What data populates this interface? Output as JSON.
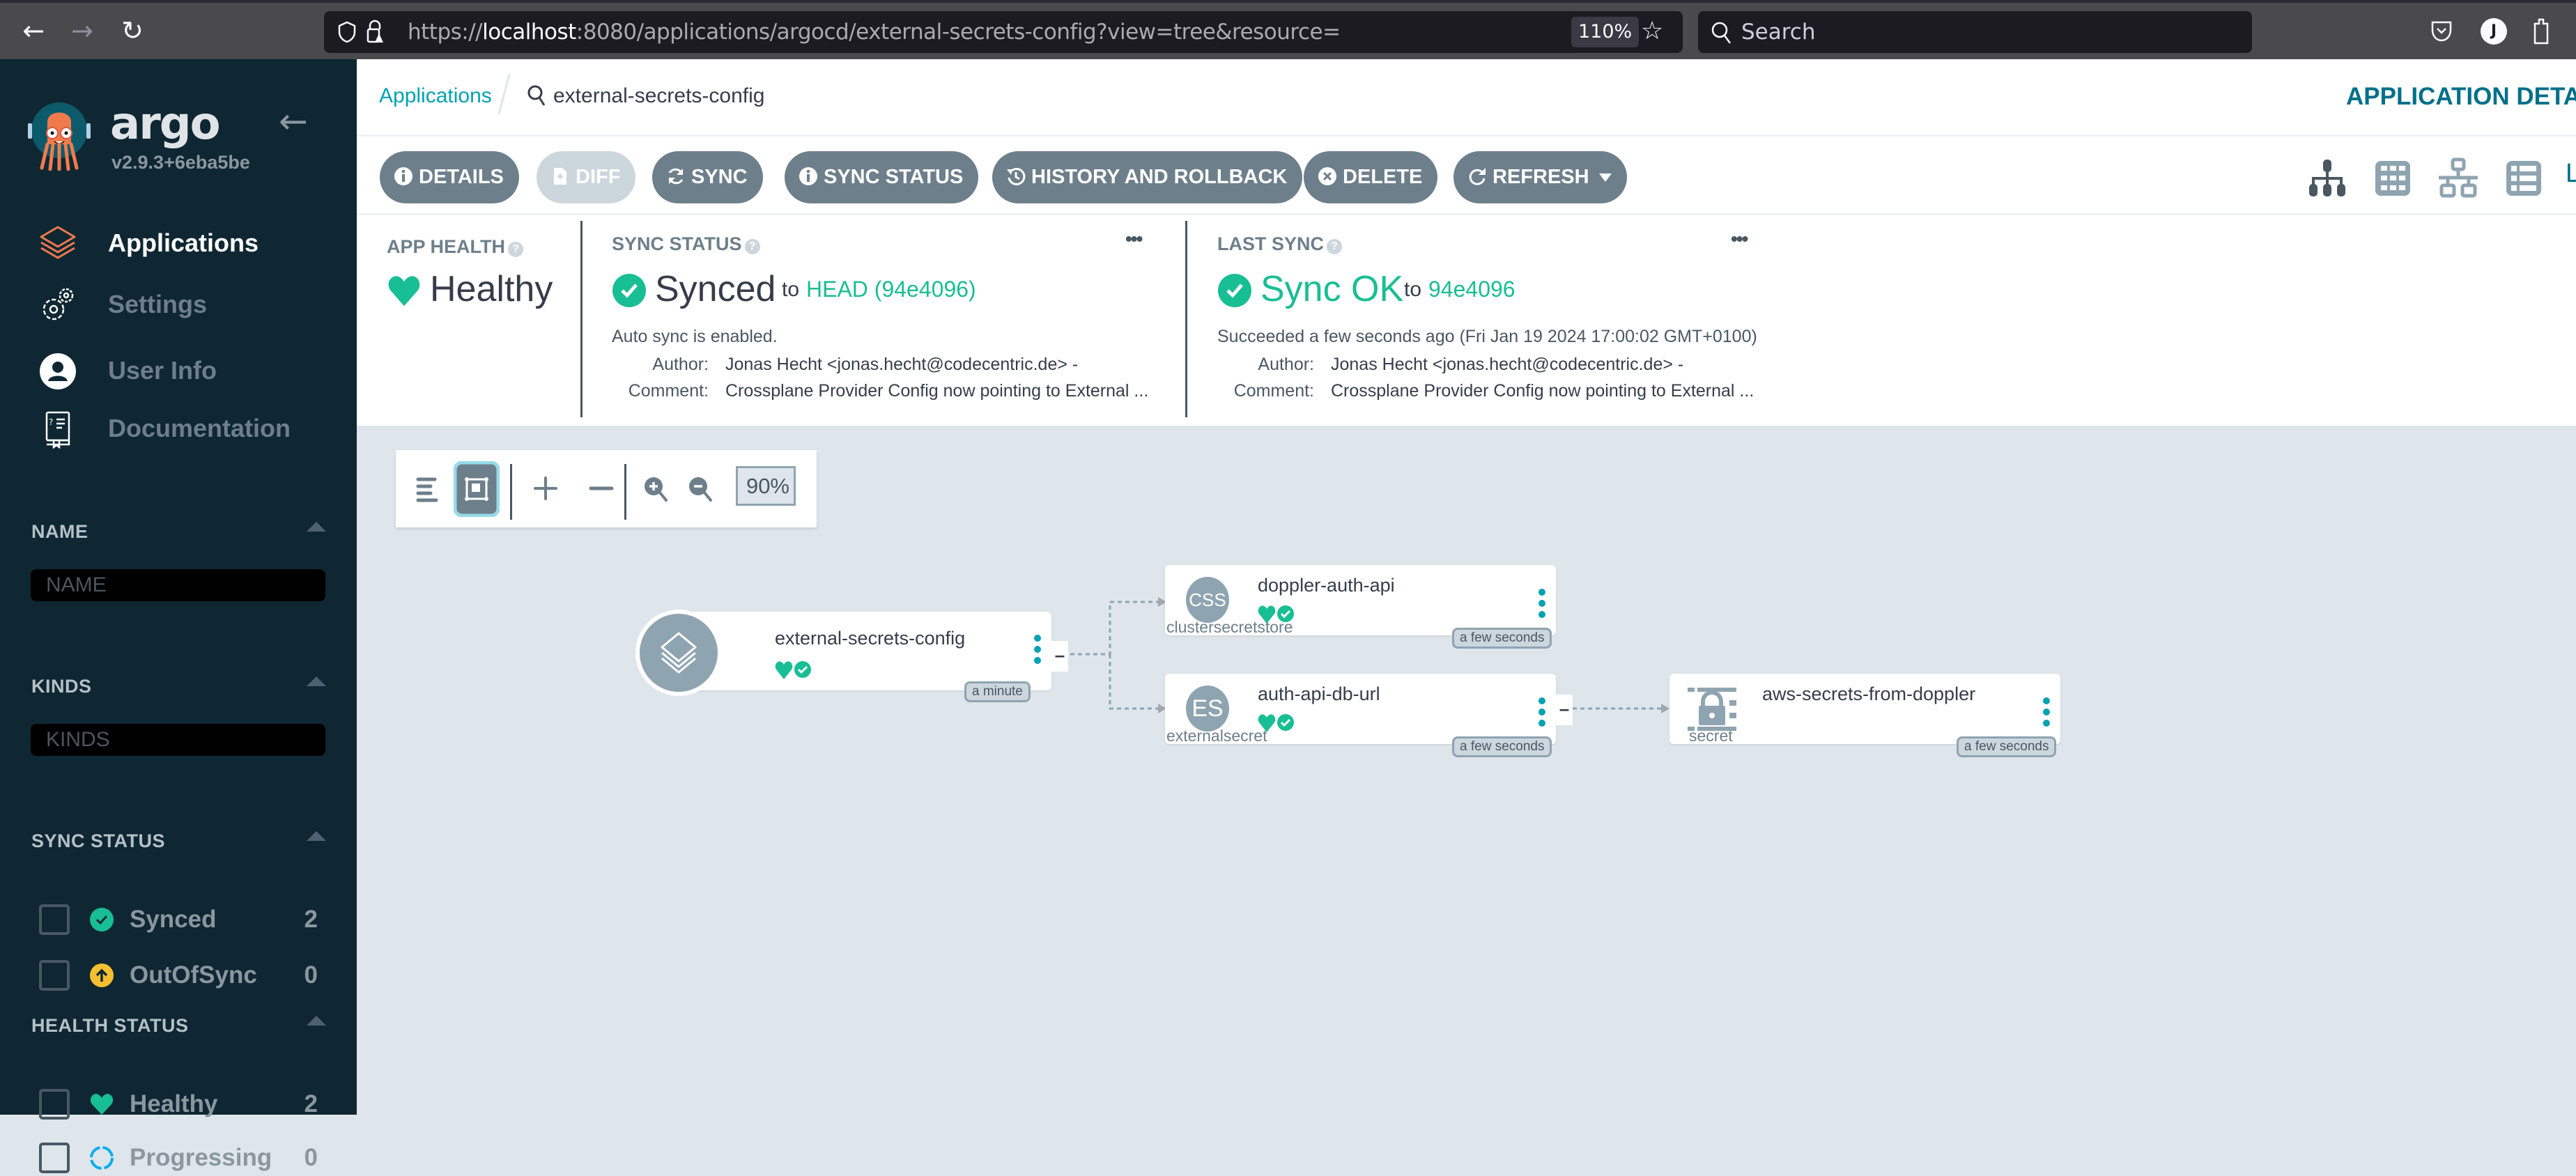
{
  "browser": {
    "url_prefix": "https://",
    "url_host": "localhost",
    "url_rest": ":8080/applications/argocd/external-secrets-config?view=tree&resource=",
    "zoom": "110%",
    "search_placeholder": "Search",
    "profile_initial": "J"
  },
  "sidebar": {
    "brand": "argo",
    "version": "v2.9.3+6eba5be",
    "nav": [
      {
        "label": "Applications",
        "icon": "layers-icon",
        "active": true
      },
      {
        "label": "Settings",
        "icon": "gears-icon",
        "active": false
      },
      {
        "label": "User Info",
        "icon": "user-circle-icon",
        "active": false
      },
      {
        "label": "Documentation",
        "icon": "book-icon",
        "active": false
      }
    ],
    "filters": {
      "name": {
        "title": "NAME",
        "placeholder": "NAME"
      },
      "kinds": {
        "title": "KINDS",
        "placeholder": "KINDS"
      },
      "sync_status": {
        "title": "SYNC STATUS",
        "items": [
          {
            "label": "Synced",
            "count": "2",
            "color": "#18be94"
          },
          {
            "label": "OutOfSync",
            "count": "0",
            "color": "#f4c030"
          }
        ]
      },
      "health_status": {
        "title": "HEALTH STATUS",
        "items": [
          {
            "label": "Healthy",
            "count": "2",
            "color": "#18be94"
          },
          {
            "label": "Progressing",
            "count": "0",
            "color": "#0dadea"
          }
        ]
      }
    }
  },
  "header": {
    "breadcrumb_root": "Applications",
    "breadcrumb_current": "external-secrets-config",
    "title": "APPLICATION DETAILS"
  },
  "toolbar": {
    "buttons": [
      {
        "label": "DETAILS",
        "icon": "info-icon",
        "disabled": false
      },
      {
        "label": "DIFF",
        "icon": "file-diff-icon",
        "disabled": true
      },
      {
        "label": "SYNC",
        "icon": "sync-icon",
        "disabled": false
      },
      {
        "label": "SYNC STATUS",
        "icon": "info-icon",
        "disabled": false
      },
      {
        "label": "HISTORY AND ROLLBACK",
        "icon": "history-icon",
        "disabled": false
      },
      {
        "label": "DELETE",
        "icon": "times-circle-icon",
        "disabled": false
      },
      {
        "label": "REFRESH",
        "icon": "redo-icon",
        "disabled": false
      }
    ],
    "views": [
      "tree",
      "pods",
      "network",
      "list"
    ],
    "active_view": "tree",
    "truncated_text": "L"
  },
  "status": {
    "app_health": {
      "title": "APP HEALTH",
      "value": "Healthy"
    },
    "sync_status": {
      "title": "SYNC STATUS",
      "value": "Synced",
      "to": "to",
      "revision": "HEAD (94e4096)",
      "auto_sync": "Auto sync is enabled.",
      "author_label": "Author:",
      "author": "Jonas Hecht <jonas.hecht@codecentric.de> -",
      "comment_label": "Comment:",
      "comment": "Crossplane Provider Config now pointing to External ..."
    },
    "last_sync": {
      "title": "LAST SYNC",
      "value": "Sync OK",
      "to": "to",
      "revision": "94e4096",
      "succeeded": "Succeeded a few seconds ago (Fri Jan 19 2024 17:00:02 GMT+0100)",
      "author_label": "Author:",
      "author": "Jonas Hecht <jonas.hecht@codecentric.de> -",
      "comment_label": "Comment:",
      "comment": "Crossplane Provider Config now pointing to External ..."
    },
    "colors": {
      "success": "#18be94",
      "text": "#363c4a",
      "accent": "#00a2b3"
    }
  },
  "graph": {
    "zoom": "90%",
    "nodes": [
      {
        "name": "external-secrets-config",
        "kind": "application",
        "kind_abbr": "",
        "age": "a minute",
        "healthy": true,
        "synced": true
      },
      {
        "name": "doppler-auth-api",
        "kind": "clustersecretstore",
        "kind_abbr": "CSS",
        "age": "a few seconds",
        "healthy": true,
        "synced": true
      },
      {
        "name": "auth-api-db-url",
        "kind": "externalsecret",
        "kind_abbr": "ES",
        "age": "a few seconds",
        "healthy": true,
        "synced": true
      },
      {
        "name": "aws-secrets-from-doppler",
        "kind": "secret",
        "kind_abbr": "",
        "age": "a few seconds",
        "healthy": false,
        "synced": false
      }
    ],
    "edges": [
      {
        "from": "external-secrets-config",
        "to": "doppler-auth-api"
      },
      {
        "from": "external-secrets-config",
        "to": "auth-api-db-url"
      },
      {
        "from": "auth-api-db-url",
        "to": "aws-secrets-from-doppler"
      }
    ]
  }
}
